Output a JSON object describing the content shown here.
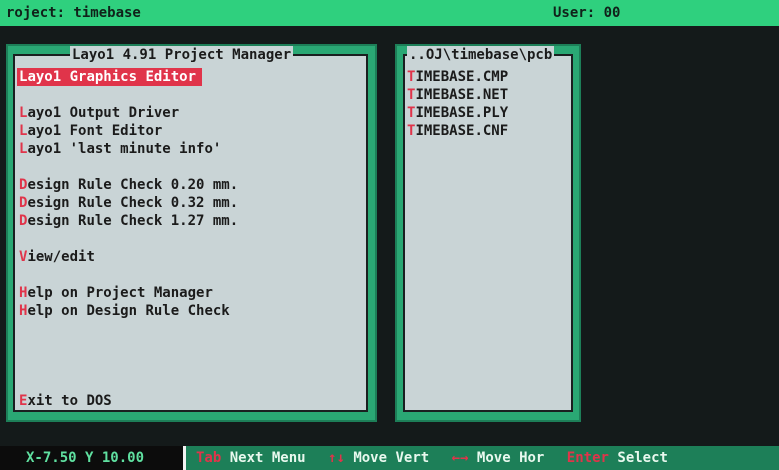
{
  "header": {
    "project": "roject: timebase",
    "user": "User: 00"
  },
  "project_manager": {
    "title": "Layo1 4.91 Project Manager",
    "items": [
      {
        "hotkey": "L",
        "rest": "ayo1 Graphics Editor",
        "selected": true
      },
      {
        "hotkey": "L",
        "rest": "ayo1 Output Driver"
      },
      {
        "hotkey": "L",
        "rest": "ayo1 Font Editor"
      },
      {
        "hotkey": "L",
        "rest": "ayo1 'last minute info'"
      },
      {
        "hotkey": "D",
        "rest": "esign Rule Check 0.20 mm."
      },
      {
        "hotkey": "D",
        "rest": "esign Rule Check 0.32 mm."
      },
      {
        "hotkey": "D",
        "rest": "esign Rule Check 1.27 mm."
      },
      {
        "hotkey": "V",
        "rest": "iew/edit"
      },
      {
        "hotkey": "H",
        "rest": "elp on Project Manager"
      },
      {
        "hotkey": "H",
        "rest": "elp on Design Rule Check"
      },
      {
        "hotkey": "E",
        "rest": "xit to DOS"
      }
    ]
  },
  "file_list": {
    "path": "..OJ\\timebase\\pcb",
    "files": [
      {
        "hotkey": "T",
        "rest": "IMEBASE.CMP"
      },
      {
        "hotkey": "T",
        "rest": "IMEBASE.NET"
      },
      {
        "hotkey": "T",
        "rest": "IMEBASE.PLY"
      },
      {
        "hotkey": "T",
        "rest": "IMEBASE.CNF"
      }
    ]
  },
  "statusbar": {
    "coords": "X-7.50  Y 10.00",
    "keys": [
      {
        "key": "Tab",
        "label": "Next Menu"
      },
      {
        "key": "↑↓",
        "label": "Move Vert"
      },
      {
        "key": "←→",
        "label": "Move Hor"
      },
      {
        "key": "Enter",
        "label": "Select"
      }
    ]
  },
  "colors": {
    "accent_green": "#2fd07e",
    "panel_green": "#2aa874",
    "panel_inner": "#c9d4d6",
    "hotkey_red": "#e0344a",
    "background": "#141a1a"
  }
}
